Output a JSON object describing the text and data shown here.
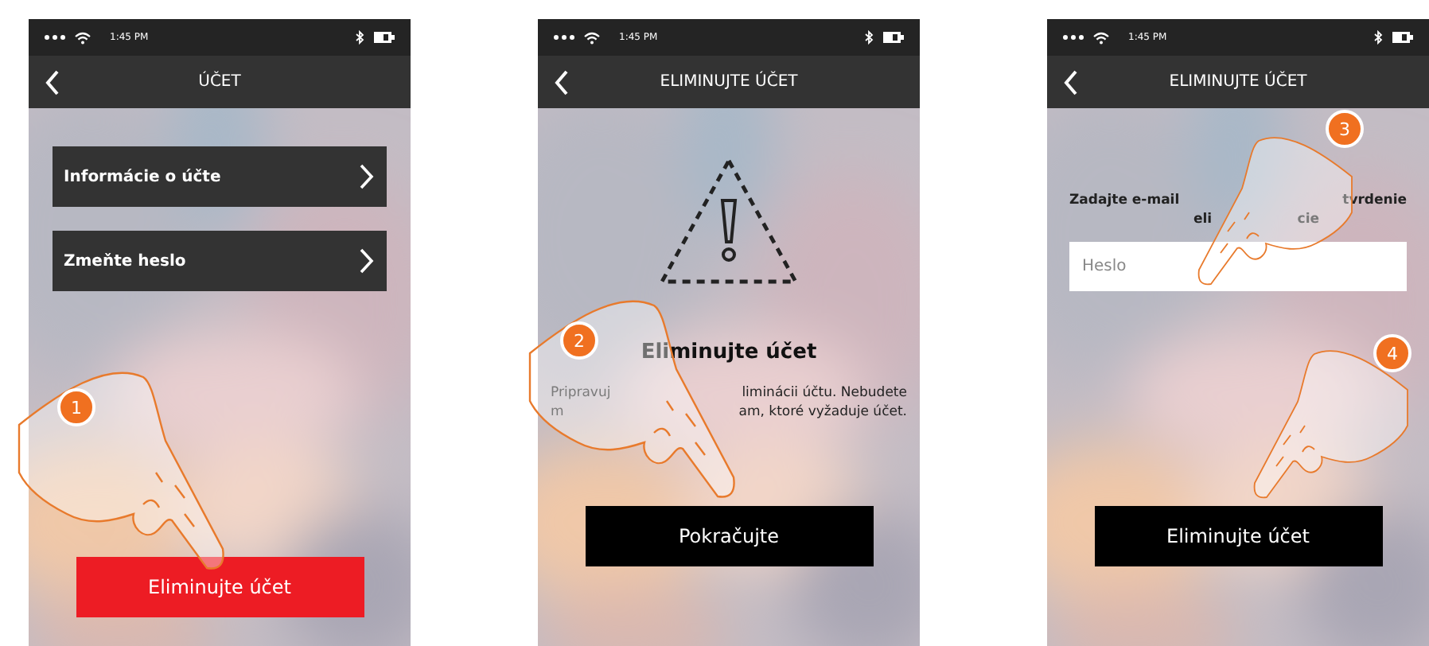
{
  "phones": [
    {
      "status": {
        "time": "1:45 PM"
      },
      "title": "ÚČET",
      "kind": "menu",
      "steps": [
        "1"
      ],
      "menu_items": [
        {
          "label": "Informácie o účte"
        },
        {
          "label": "Zmeňte heslo"
        }
      ],
      "button": {
        "label": "Eliminujte účet"
      }
    },
    {
      "status": {
        "time": "1:45 PM"
      },
      "title": "ELIMINUJTE ÚČET",
      "kind": "warning",
      "steps": [
        "2"
      ],
      "heading": "Eliminujte účet",
      "lines": [
        {
          "left": "Pripravuj",
          "right": "liminácii účtu. Nebudete"
        },
        {
          "left": "m",
          "right": "am, ktoré vyžaduje účet."
        }
      ],
      "button": {
        "label": "Pokračujte"
      }
    },
    {
      "status": {
        "time": "1:45 PM"
      },
      "title": "ELIMINUJTE ÚČET",
      "kind": "form",
      "steps": [
        "3",
        "4"
      ],
      "lines": [
        {
          "left": "Zadajte e-mail",
          "right": "tvrdenie"
        },
        {
          "left": "eli",
          "right": "cie"
        }
      ],
      "field": {
        "placeholder": "Heslo"
      },
      "button": {
        "label": "Eliminujte účet"
      }
    }
  ]
}
